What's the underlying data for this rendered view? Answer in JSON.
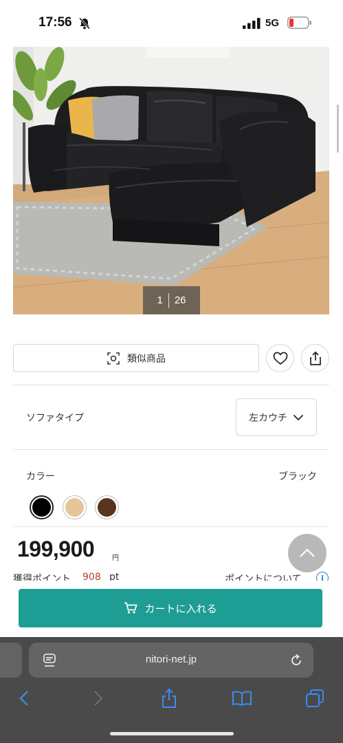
{
  "status_bar": {
    "time": "17:56",
    "network": "5G",
    "icons": [
      "bell-slash-icon",
      "signal-icon",
      "battery-low-icon"
    ]
  },
  "gallery": {
    "current": "1",
    "total": "26"
  },
  "actions": {
    "similar_label": "類似商品",
    "icons": [
      "camera-search-icon",
      "heart-icon",
      "share-icon"
    ]
  },
  "sofa_type": {
    "label": "ソファタイプ",
    "selected": "左カウチ"
  },
  "color": {
    "label": "カラー",
    "selected_name": "ブラック",
    "swatches": [
      {
        "name": "black",
        "hex": "#000000",
        "selected": true
      },
      {
        "name": "beige",
        "hex": "#e8c49a",
        "selected": false
      },
      {
        "name": "brown",
        "hex": "#5b3421",
        "selected": false
      }
    ]
  },
  "price": {
    "value": "199,900",
    "unit": "円"
  },
  "points": {
    "label": "獲得ポイント",
    "value": "908",
    "unit": "pt",
    "about_link": "ポイントについて"
  },
  "cart": {
    "label": "カートに入れる",
    "color": "#1e9d94"
  },
  "browser": {
    "url": "nitori-net.jp",
    "toolbar_icons": [
      "back-icon",
      "forward-icon",
      "share-icon",
      "bookmarks-icon",
      "tabs-icon"
    ]
  }
}
